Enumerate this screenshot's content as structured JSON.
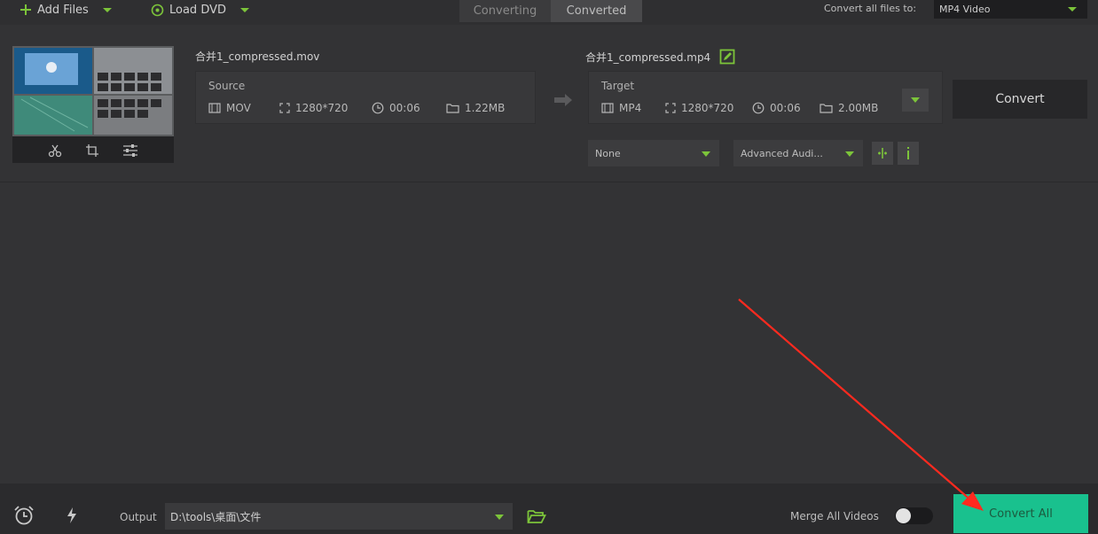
{
  "toolbar": {
    "add_files": "Add Files",
    "load_dvd": "Load DVD",
    "tabs": [
      {
        "label": "Converting",
        "active": false
      },
      {
        "label": "Converted",
        "active": true
      }
    ],
    "convert_all_to_label": "Convert all files to:",
    "convert_all_to_value": "MP4 Video"
  },
  "file": {
    "source_name": "合并1_compressed.mov",
    "target_name": "合并1_compressed.mp4",
    "source": {
      "title": "Source",
      "format": "MOV",
      "resolution": "1280*720",
      "duration": "00:06",
      "size": "1.22MB"
    },
    "target": {
      "title": "Target",
      "format": "MP4",
      "resolution": "1280*720",
      "duration": "00:06",
      "size": "2.00MB"
    },
    "convert_label": "Convert",
    "subtitle_select": "None",
    "audio_select": "Advanced Audi..."
  },
  "bottom": {
    "output_label": "Output",
    "output_path": "D:\\tools\\桌面\\文件",
    "merge_label": "Merge All Videos",
    "merge_enabled": false,
    "convert_all_label": "Convert All"
  },
  "colors": {
    "accent_green": "#7cc43a",
    "convert_all_bg": "#19c18e",
    "annotation_red": "#ff2a1f"
  }
}
